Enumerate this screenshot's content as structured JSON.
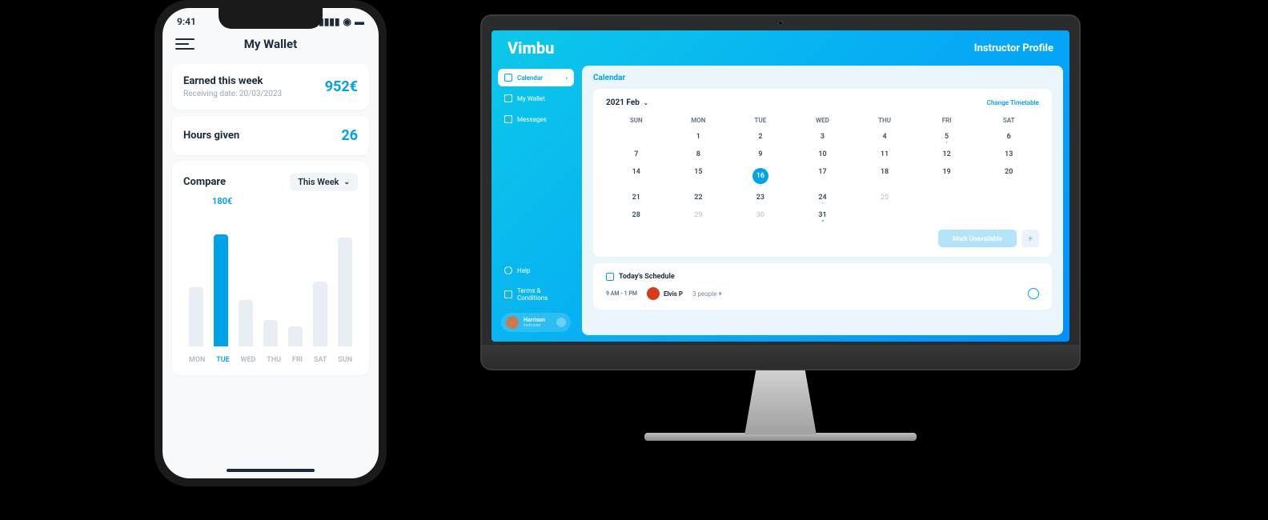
{
  "phone": {
    "status_time": "9:41",
    "title": "My Wallet",
    "earned_card": {
      "label": "Earned this week",
      "value": "952€",
      "sub_prefix": "Receiving date: ",
      "sub_date": "20/03/2023"
    },
    "hours_card": {
      "label": "Hours given",
      "value": "26"
    },
    "compare": {
      "label": "Compare",
      "range": "This Week",
      "highlight_value": "180€"
    }
  },
  "desktop": {
    "logo": "Vimbu",
    "profile_label": "Instructor Profile",
    "sidebar": {
      "items": [
        {
          "label": "Calendar",
          "active": true
        },
        {
          "label": "My Wallet",
          "active": false
        },
        {
          "label": "Messages",
          "active": false
        }
      ],
      "help": "Help",
      "terms": "Terms & Conditions",
      "user_name": "Harrison",
      "user_role": "Instructor"
    },
    "main_title": "Calendar",
    "calendar": {
      "month_label": "2021 Feb",
      "change_label": "Change Timetable",
      "dow": [
        "SUN",
        "MON",
        "TUE",
        "WED",
        "THU",
        "FRI",
        "SAT"
      ],
      "weeks": [
        [
          {
            "n": "",
            "e": true
          },
          {
            "n": "1"
          },
          {
            "n": "2"
          },
          {
            "n": "3"
          },
          {
            "n": "4"
          },
          {
            "n": "5",
            "dot": true
          },
          {
            "n": "6"
          }
        ],
        [
          {
            "n": "7"
          },
          {
            "n": "8"
          },
          {
            "n": "9"
          },
          {
            "n": "10"
          },
          {
            "n": "11"
          },
          {
            "n": "12"
          },
          {
            "n": "13"
          }
        ],
        [
          {
            "n": "14"
          },
          {
            "n": "15"
          },
          {
            "n": "16",
            "sel": true,
            "dot": true
          },
          {
            "n": "17"
          },
          {
            "n": "18"
          },
          {
            "n": "19"
          },
          {
            "n": "20"
          }
        ],
        [
          {
            "n": "21"
          },
          {
            "n": "22"
          },
          {
            "n": "23"
          },
          {
            "n": "24",
            "dot": true
          },
          {
            "n": "25",
            "fade": true
          },
          {
            "n": "",
            "e": true
          },
          {
            "n": "",
            "e": true
          }
        ],
        [
          {
            "n": "28"
          },
          {
            "n": "29",
            "fade": true
          },
          {
            "n": "30",
            "fade": true
          },
          {
            "n": "31",
            "dots": true
          },
          {
            "n": "",
            "e": true
          },
          {
            "n": "",
            "e": true
          },
          {
            "n": "",
            "e": true
          }
        ]
      ],
      "unavailable_btn": "Mark Unavailable"
    },
    "today": {
      "title": "Today's Schedule",
      "time_range": "9 AM - 1 PM",
      "person_name": "Elvis P",
      "people_count": "3 people",
      "people_extra": "+"
    }
  },
  "chart_data": {
    "type": "bar",
    "title": "Compare",
    "categories": [
      "MON",
      "TUE",
      "WED",
      "THU",
      "FRI",
      "SAT",
      "SUN"
    ],
    "values": [
      95,
      180,
      75,
      42,
      32,
      105,
      175
    ],
    "highlight_index": 1,
    "highlight_label": "180€",
    "ylabel": "€",
    "ylim": [
      0,
      200
    ]
  }
}
